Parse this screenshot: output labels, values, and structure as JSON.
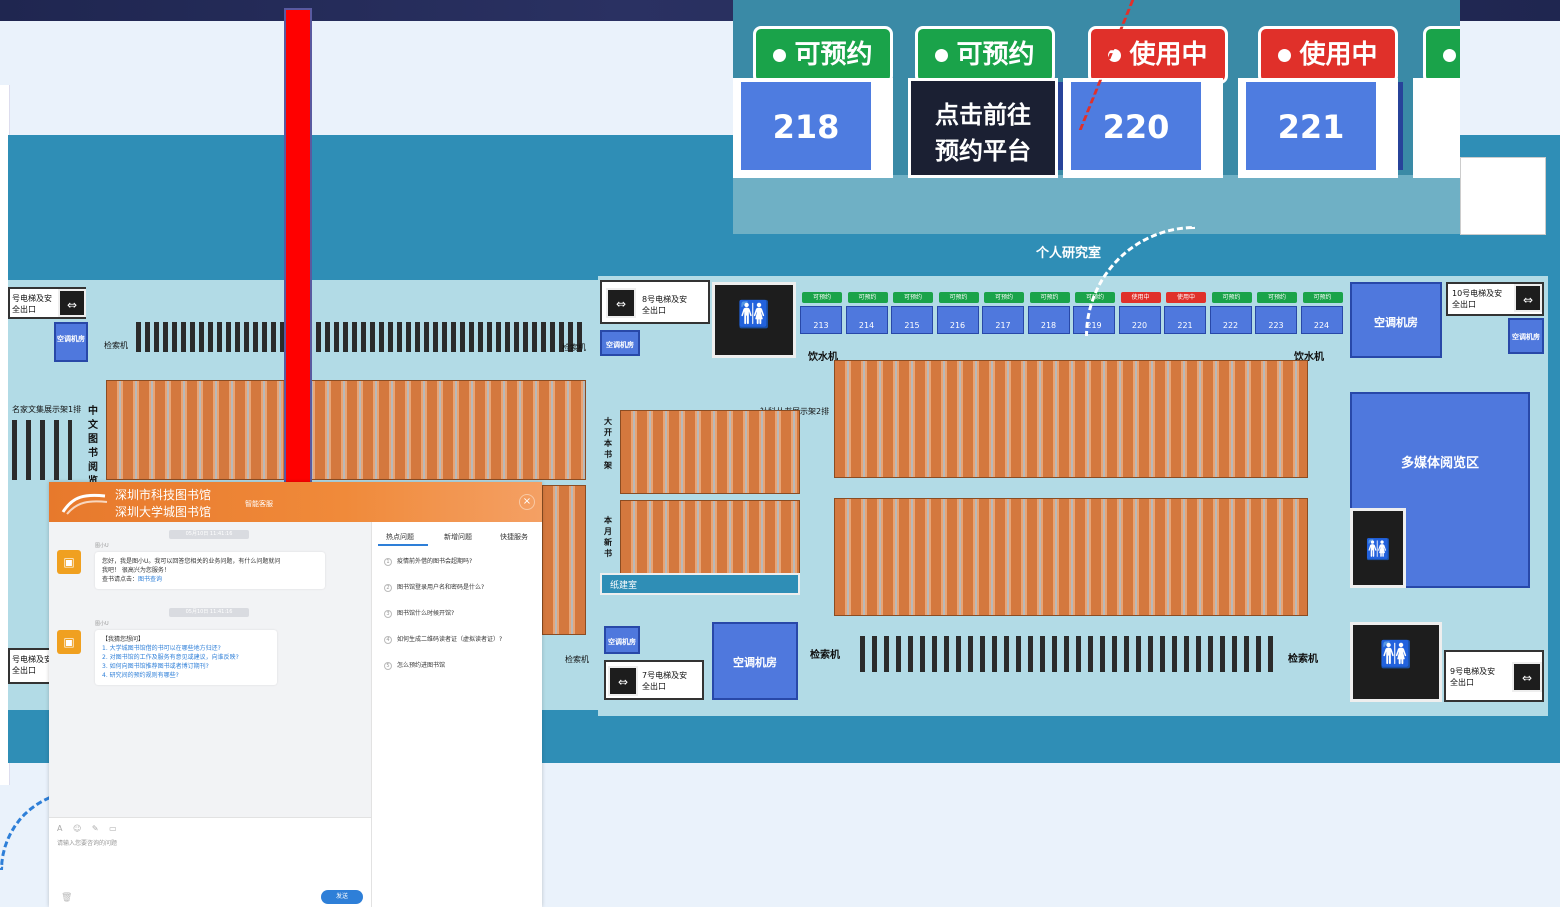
{
  "zoom": {
    "tags": [
      {
        "text": "可预约",
        "color": "#1aa34a"
      },
      {
        "text": "可预约",
        "color": "#1aa34a"
      },
      {
        "text": "使用中",
        "color": "#e0302a"
      },
      {
        "text": "使用中",
        "color": "#e0302a"
      }
    ],
    "rooms": [
      "218",
      "220",
      "221"
    ],
    "cta_line1": "点击前往",
    "cta_line2": "预约平台"
  },
  "plan": {
    "study_label": "个人研究室",
    "study_rooms": [
      {
        "num": "213",
        "status": "可预约",
        "state": "green"
      },
      {
        "num": "214",
        "status": "可预约",
        "state": "green"
      },
      {
        "num": "215",
        "status": "可预约",
        "state": "green"
      },
      {
        "num": "216",
        "status": "可预约",
        "state": "green"
      },
      {
        "num": "217",
        "status": "可预约",
        "state": "green"
      },
      {
        "num": "218",
        "status": "可预约",
        "state": "green"
      },
      {
        "num": "219",
        "status": "可预约",
        "state": "green"
      },
      {
        "num": "220",
        "status": "使用中",
        "state": "red"
      },
      {
        "num": "221",
        "status": "使用中",
        "state": "red"
      },
      {
        "num": "222",
        "status": "可预约",
        "state": "green"
      },
      {
        "num": "223",
        "status": "可预约",
        "state": "green"
      },
      {
        "num": "224",
        "status": "可预约",
        "state": "green"
      }
    ],
    "exit_8": "8号电梯及安全出口",
    "exit_10": "10号电梯及安全出口",
    "exit_9": "9号电梯及安全出口",
    "exit_7": "7号电梯及安全出口",
    "exit_left_top": "号电梯及安全出口",
    "exit_left_bottom": "号电梯及安全出口",
    "water_left": "饮水机",
    "water_right": "饮水机",
    "ac_room": "空调机房",
    "ac_small": "空调机房",
    "search_pc": "检索机",
    "multimedia": "多媒体阅览区",
    "big_shelf": "大开本书架",
    "new_books": "本月新书",
    "exhibit": "社科丛书展示架2排",
    "famous": "名家文集展示架1排",
    "chinese_reading": "中文图书阅览",
    "digital_room": "纸建室"
  },
  "chat": {
    "org1": "深圳市科技图书馆",
    "org2": "深圳大学城图书馆",
    "subtitle": "智能客服",
    "close": "×",
    "time1": "05月10日 11:41:16",
    "time2": "05月10日 11:41:16",
    "bot_name": "图小U",
    "greeting_line1": "您好，我是图小U。我可以回答您相关的业务问题，有什么问题就问",
    "greeting_line2": "我吧！ 很高兴为您服务！",
    "search_prefix": "查书请点击：",
    "search_link": "图书查询",
    "guess_title": "【我猜您想问】",
    "guesses": [
      "1. 大学城图书馆借的书可以在哪些地方归还?",
      "2. 对图书馆的工作及服务有意见或建议，向谁反映?",
      "3. 如何向图书馆推荐图书或者博订期刊?",
      "4. 研究间的预约规则有哪些?"
    ],
    "tabs": [
      "热点问题",
      "新增问题",
      "快捷服务"
    ],
    "hot_questions": [
      "疫情前外借的图书会超期吗?",
      "图书馆登录用户名和密码是什么?",
      "图书馆什么时候开馆?",
      "如何生成二维码读者证（虚拟读者证）?",
      "怎么预约进图书馆"
    ],
    "input_placeholder": "请输入您要咨询的问题",
    "send": "发送"
  }
}
